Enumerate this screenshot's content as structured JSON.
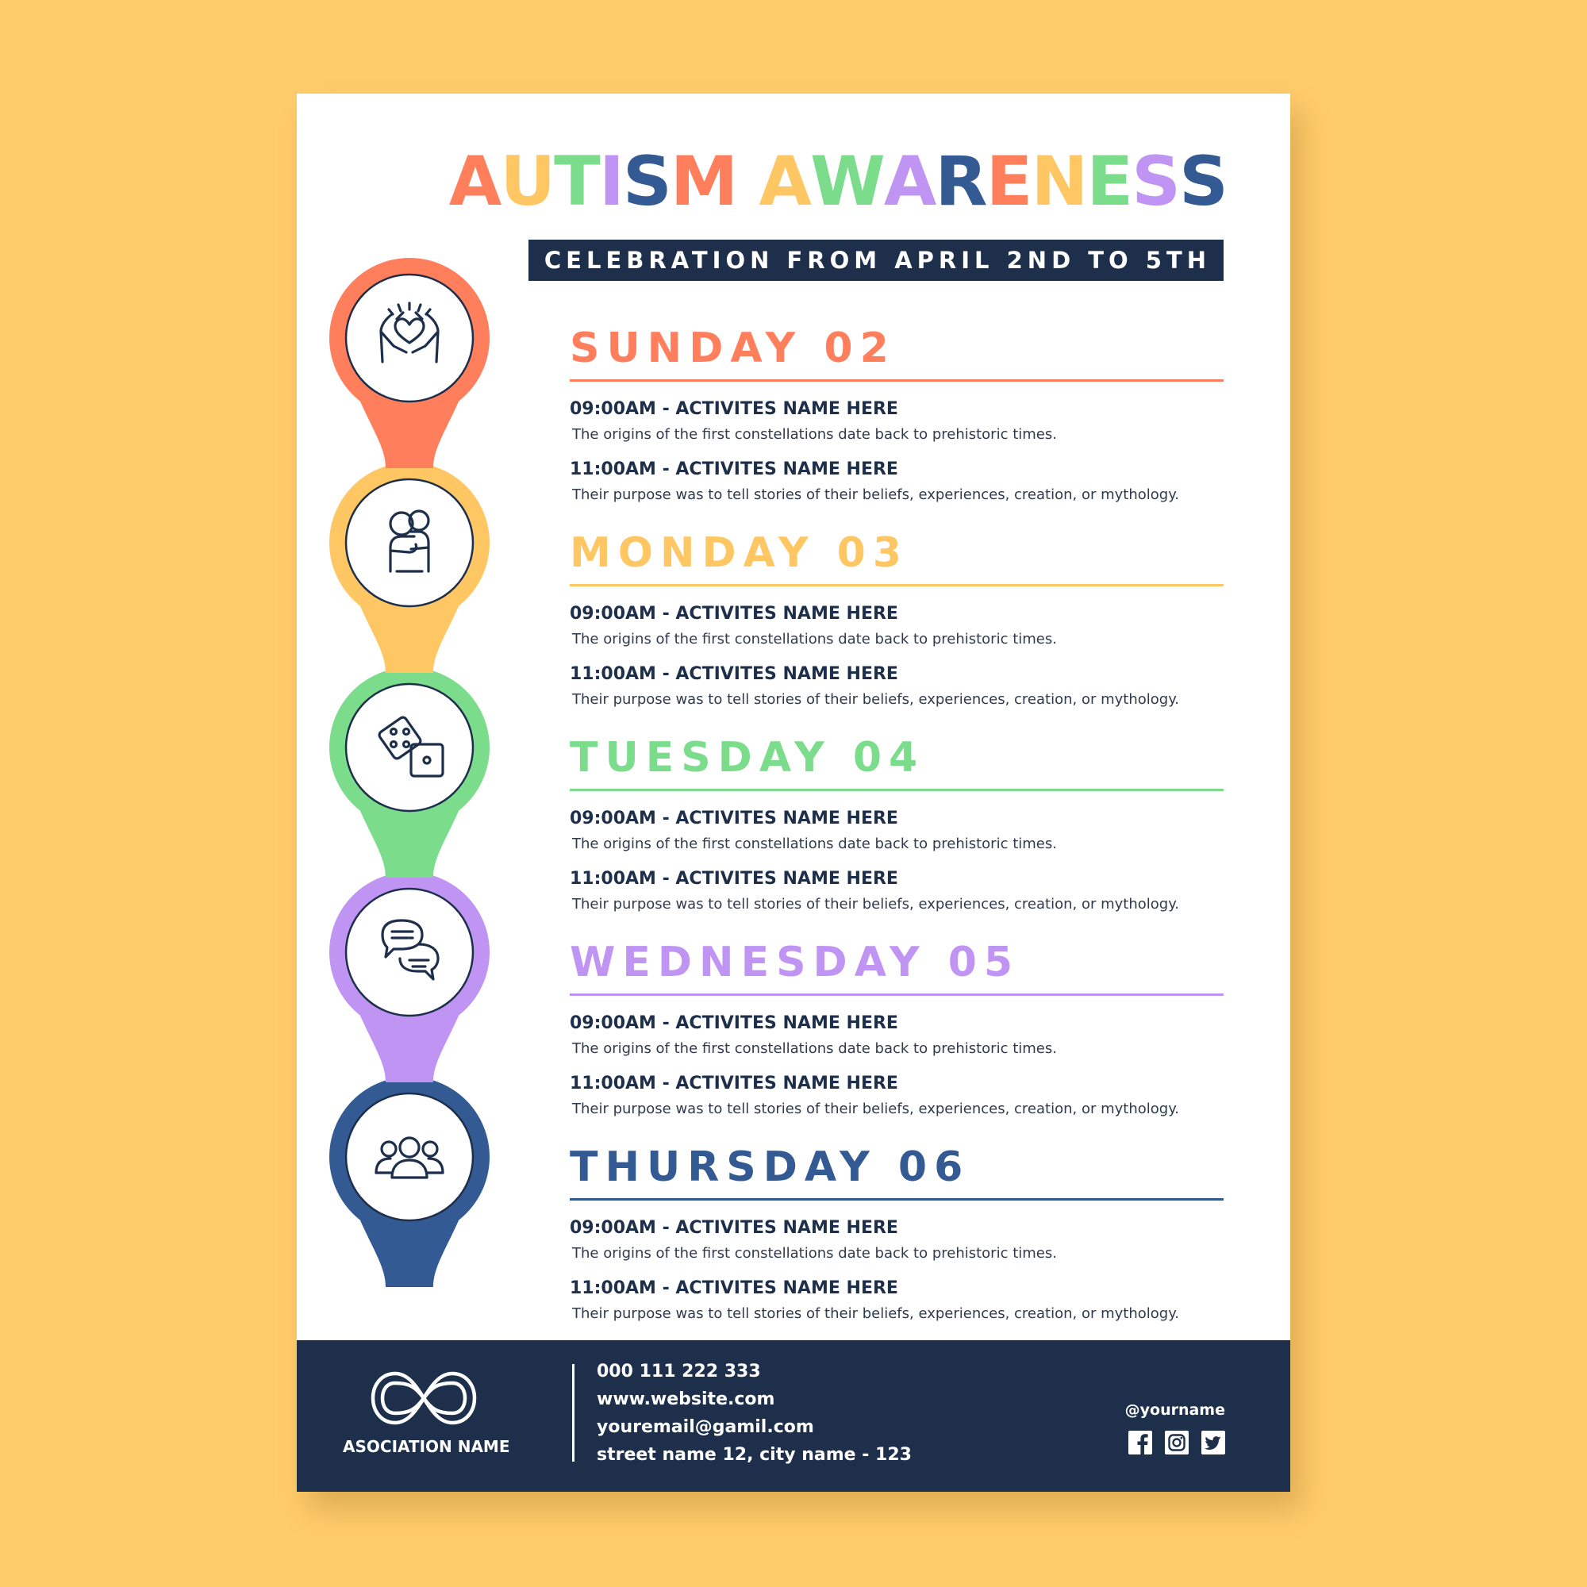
{
  "title": {
    "letters": [
      {
        "char": "A",
        "color": "#FF7E5C"
      },
      {
        "char": "U",
        "color": "#FFC764"
      },
      {
        "char": "T",
        "color": "#7BDC8C"
      },
      {
        "char": "I",
        "color": "#C094F2"
      },
      {
        "char": "S",
        "color": "#335A92"
      },
      {
        "char": "M",
        "color": "#FF7E5C"
      },
      {
        "char": " ",
        "color": "#ffffff"
      },
      {
        "char": "A",
        "color": "#FFC764"
      },
      {
        "char": "W",
        "color": "#7BDC8C"
      },
      {
        "char": "A",
        "color": "#C094F2"
      },
      {
        "char": "R",
        "color": "#335A92"
      },
      {
        "char": "E",
        "color": "#FF7E5C"
      },
      {
        "char": "N",
        "color": "#FFC764"
      },
      {
        "char": "E",
        "color": "#7BDC8C"
      },
      {
        "char": "S",
        "color": "#C094F2"
      },
      {
        "char": "S",
        "color": "#335A92"
      }
    ]
  },
  "subtitle": "CELEBRATION FROM APRIL 2ND TO 5TH",
  "colors": {
    "background": "#FFCC6B",
    "navy": "#1D2F4B",
    "coral": "#FF7E5C",
    "yellow": "#FFC764",
    "green": "#7BDC8C",
    "purple": "#C094F2",
    "blue": "#335A92"
  },
  "days": [
    {
      "title": "SUNDAY 02",
      "color": "#FF7E5C",
      "icon": "heart-hands-icon",
      "activities": [
        {
          "time_title": "09:00AM - ACTIVITES NAME HERE",
          "desc": "The origins of the first constellations date back to prehistoric times."
        },
        {
          "time_title": "11:00AM - ACTIVITES NAME HERE",
          "desc": "Their purpose was to tell stories of their beliefs, experiences, creation, or mythology."
        }
      ]
    },
    {
      "title": "MONDAY 03",
      "color": "#FFC764",
      "icon": "hug-icon",
      "activities": [
        {
          "time_title": "09:00AM - ACTIVITES NAME HERE",
          "desc": "The origins of the first constellations date back to prehistoric times."
        },
        {
          "time_title": "11:00AM - ACTIVITES NAME HERE",
          "desc": "Their purpose was to tell stories of their beliefs, experiences, creation, or mythology."
        }
      ]
    },
    {
      "title": "TUESDAY 04",
      "color": "#7BDC8C",
      "icon": "dice-icon",
      "activities": [
        {
          "time_title": "09:00AM - ACTIVITES NAME HERE",
          "desc": "The origins of the first constellations date back to prehistoric times."
        },
        {
          "time_title": "11:00AM - ACTIVITES NAME HERE",
          "desc": "Their purpose was to tell stories of their beliefs, experiences, creation, or mythology."
        }
      ]
    },
    {
      "title": "WEDNESDAY 05",
      "color": "#C094F2",
      "icon": "chat-bubbles-icon",
      "activities": [
        {
          "time_title": "09:00AM - ACTIVITES NAME HERE",
          "desc": "The origins of the first constellations date back to prehistoric times."
        },
        {
          "time_title": "11:00AM - ACTIVITES NAME HERE",
          "desc": "Their purpose was to tell stories of their beliefs, experiences, creation, or mythology."
        }
      ]
    },
    {
      "title": "THURSDAY 06",
      "color": "#335A92",
      "icon": "group-icon",
      "activities": [
        {
          "time_title": "09:00AM - ACTIVITES NAME HERE",
          "desc": "The origins of the first constellations date back to prehistoric times."
        },
        {
          "time_title": "11:00AM - ACTIVITES NAME HERE",
          "desc": "Their purpose was to tell stories of their beliefs, experiences, creation, or mythology."
        }
      ]
    }
  ],
  "footer": {
    "logo_icon": "infinity-icon",
    "association": "ASOCIATION NAME",
    "contacts": [
      "000 111 222 333",
      "www.website.com",
      "youremail@gamil.com",
      "street name 12, city name - 123"
    ],
    "handle": "@yourname",
    "socials": [
      "facebook-icon",
      "instagram-icon",
      "twitter-icon"
    ]
  }
}
